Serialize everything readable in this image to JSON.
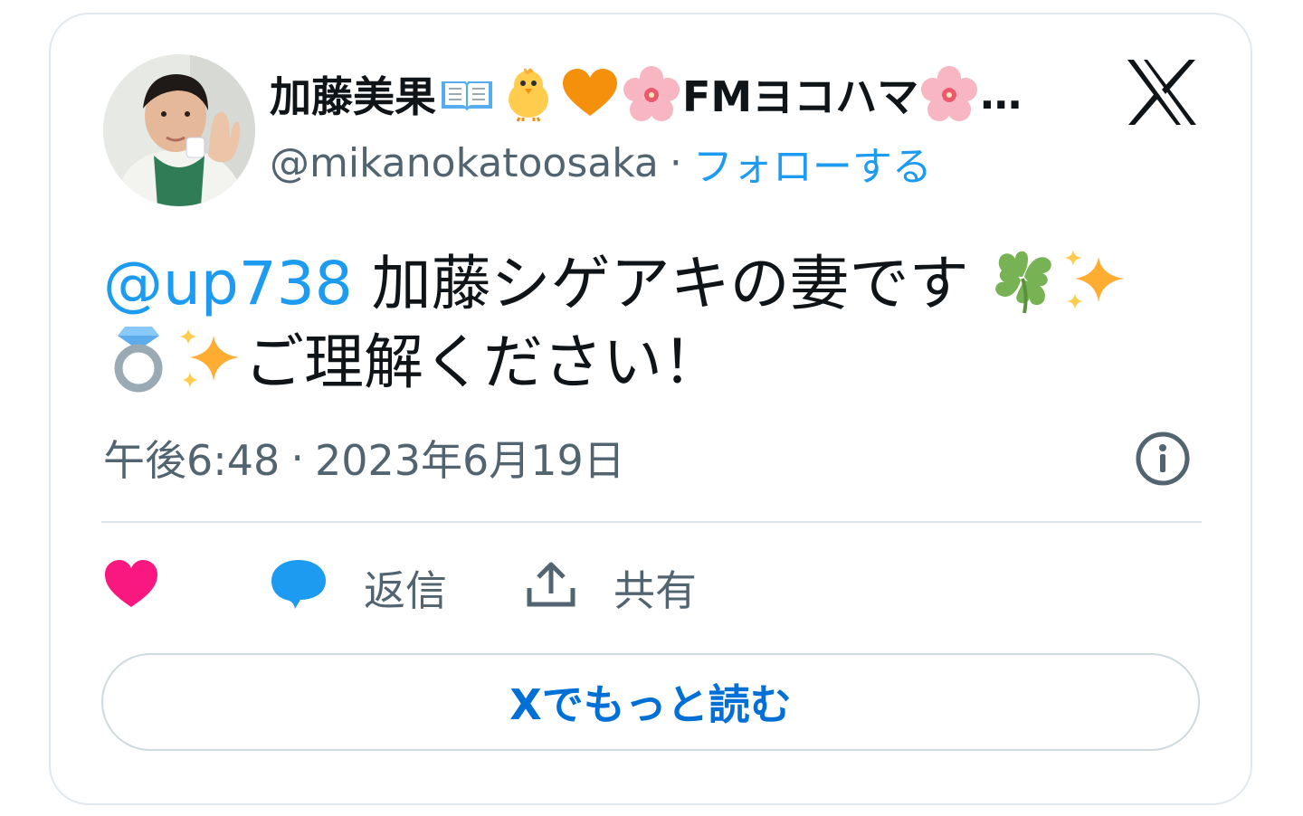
{
  "author": {
    "display_name_start": "加藤美果",
    "display_name_middle": "FMヨコハマ",
    "display_name_ellipsis": "…",
    "handle": "@mikanokatoosaka",
    "separator": "·",
    "follow_label": "フォローする"
  },
  "tweet": {
    "mention": "@up738",
    "text_line1": " 加藤シゲアキの妻です",
    "text_line2": "ご理解ください！",
    "time": "午後6:48",
    "separator": "·",
    "date": "2023年6月19日"
  },
  "actions": {
    "reply_label": "返信",
    "share_label": "共有"
  },
  "read_more_label": "Xでもっと読む",
  "icons": [
    "open-book-icon",
    "baby-chick-icon",
    "orange-heart-icon",
    "cherry-blossom-icon",
    "four-leaf-clover-icon",
    "sparkles-icon",
    "ring-icon",
    "x-logo-icon",
    "info-icon",
    "heart-icon",
    "reply-bubble-icon",
    "share-upload-icon"
  ],
  "colors": {
    "accent": "#1d9bf0",
    "like": "#f91880",
    "link_button": "#006fd6",
    "muted": "#536471"
  }
}
